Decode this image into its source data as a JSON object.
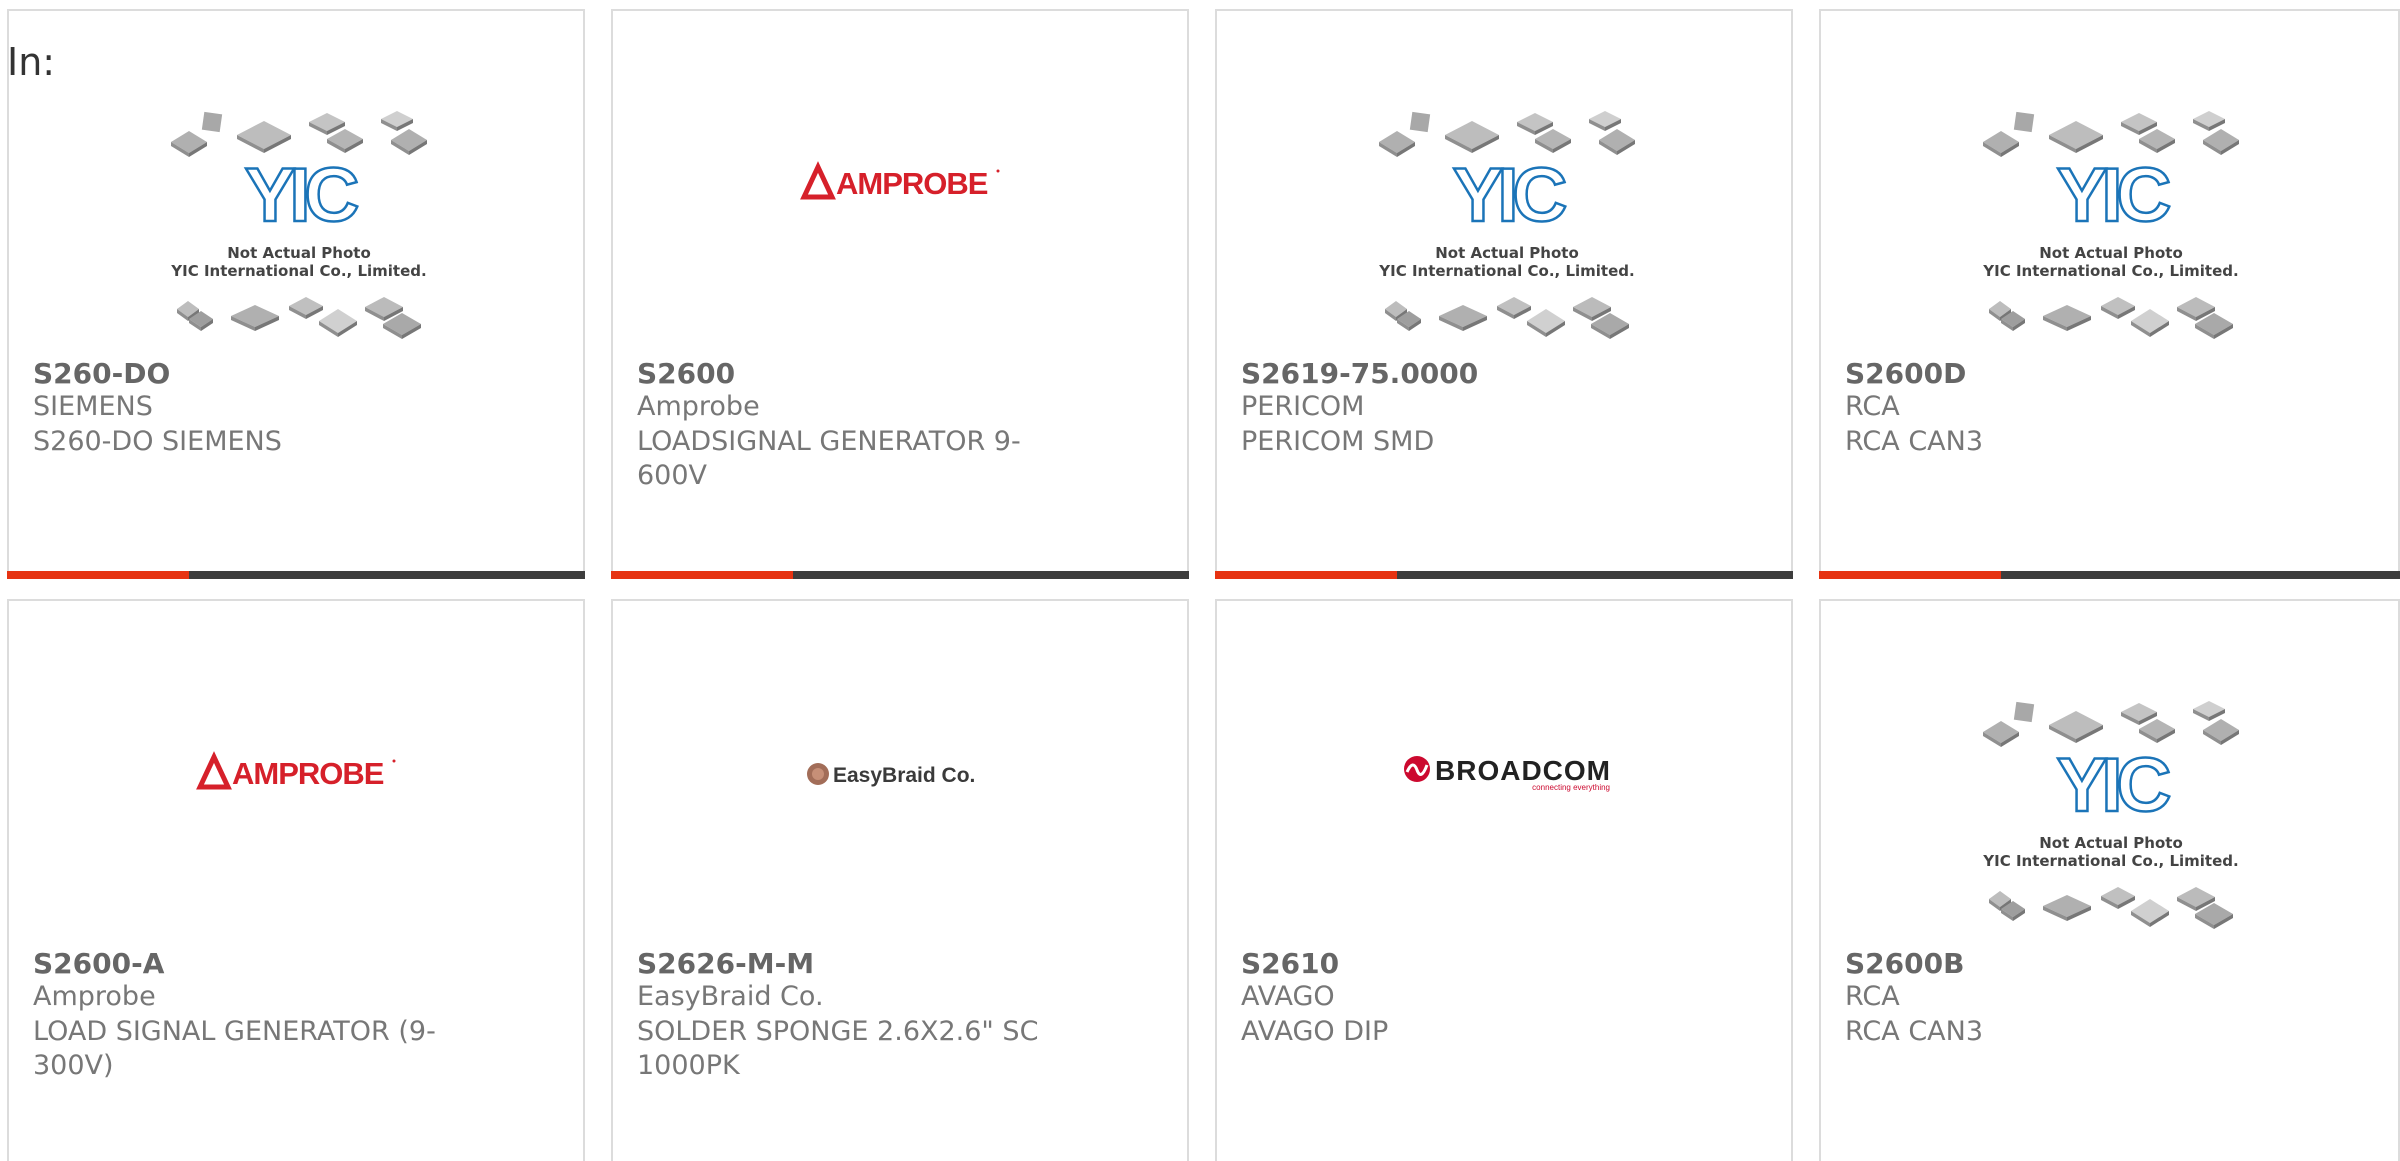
{
  "in_label": "In:",
  "colors": {
    "accent": "#e63312",
    "bar": "#3d3d3d",
    "amprobe_red": "#d6202a",
    "broadcom_red": "#cc092f",
    "yic_blue": "#1b74b8"
  },
  "placeholder": {
    "line1": "Not Actual Photo",
    "line2": "YIC International Co., Limited.",
    "logo_text": "YIC"
  },
  "logos": {
    "amprobe": "AMPROBE",
    "easybraid": "EasyBraid Co.",
    "broadcom": "BROADCOM",
    "broadcom_tag": "connecting everything"
  },
  "products": [
    {
      "part": "S260-DO",
      "brand": "SIEMENS",
      "desc": "S260-DO SIEMENS",
      "image": "yic-placeholder"
    },
    {
      "part": "S2600",
      "brand": "Amprobe",
      "desc": "LOADSIGNAL GENERATOR 9-600V",
      "image": "amprobe-logo"
    },
    {
      "part": "S2619-75.0000",
      "brand": "PERICOM",
      "desc": "PERICOM SMD",
      "image": "yic-placeholder"
    },
    {
      "part": "S2600D",
      "brand": "RCA",
      "desc": "RCA CAN3",
      "image": "yic-placeholder"
    },
    {
      "part": "S2600-A",
      "brand": "Amprobe",
      "desc": "LOAD SIGNAL GENERATOR (9-300V)",
      "image": "amprobe-logo"
    },
    {
      "part": "S2626-M-M",
      "brand": "EasyBraid Co.",
      "desc": "SOLDER SPONGE 2.6X2.6\" SC 1000PK",
      "image": "easybraid-logo"
    },
    {
      "part": "S2610",
      "brand": "AVAGO",
      "desc": "AVAGO DIP",
      "image": "broadcom-logo"
    },
    {
      "part": "S2600B",
      "brand": "RCA",
      "desc": "RCA CAN3",
      "image": "yic-placeholder"
    }
  ]
}
